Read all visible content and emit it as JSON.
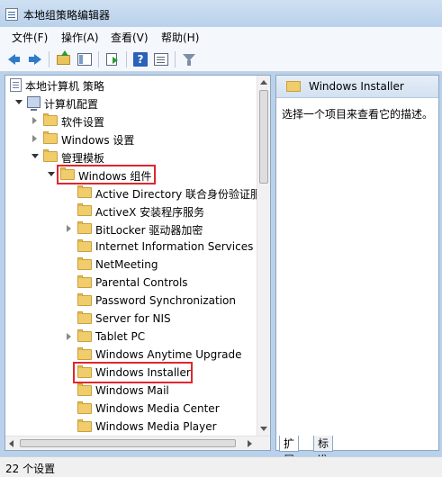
{
  "window": {
    "title": "本地组策略编辑器"
  },
  "menu": [
    "文件(F)",
    "操作(A)",
    "查看(V)",
    "帮助(H)"
  ],
  "toolbar": [
    "back-icon",
    "forward-icon",
    "folder-up-icon",
    "show-hide-tree-icon",
    "export-list-icon",
    "help-icon",
    "properties-icon",
    "filter-icon"
  ],
  "tree": [
    {
      "label": "本地计算机 策略",
      "icon": "policy-icon",
      "expand": "none"
    },
    {
      "label": "计算机配置",
      "icon": "computer-icon",
      "expand": "open"
    },
    {
      "label": "软件设置",
      "icon": "folder-icon",
      "expand": "closed"
    },
    {
      "label": "Windows 设置",
      "icon": "folder-icon",
      "expand": "closed"
    },
    {
      "label": "管理模板",
      "icon": "folder-icon",
      "expand": "open"
    },
    {
      "label": "Windows 组件",
      "icon": "folder-icon",
      "expand": "open",
      "highlighted": true
    },
    {
      "label": "Active Directory 联合身份验证服",
      "icon": "folder-icon",
      "expand": "none"
    },
    {
      "label": "ActiveX 安装程序服务",
      "icon": "folder-icon",
      "expand": "none"
    },
    {
      "label": "BitLocker 驱动器加密",
      "icon": "folder-icon",
      "expand": "closed"
    },
    {
      "label": "Internet Information Services",
      "icon": "folder-icon",
      "expand": "none"
    },
    {
      "label": "NetMeeting",
      "icon": "folder-icon",
      "expand": "none"
    },
    {
      "label": "Parental Controls",
      "icon": "folder-icon",
      "expand": "none"
    },
    {
      "label": "Password Synchronization",
      "icon": "folder-icon",
      "expand": "none"
    },
    {
      "label": "Server for NIS",
      "icon": "folder-icon",
      "expand": "none"
    },
    {
      "label": "Tablet PC",
      "icon": "folder-icon",
      "expand": "closed"
    },
    {
      "label": "Windows Anytime Upgrade",
      "icon": "folder-icon",
      "expand": "none"
    },
    {
      "label": "Windows Installer",
      "icon": "folder-icon",
      "expand": "none",
      "highlighted": true
    },
    {
      "label": "Windows Mail",
      "icon": "folder-icon",
      "expand": "none"
    },
    {
      "label": "Windows Media Center",
      "icon": "folder-icon",
      "expand": "none"
    },
    {
      "label": "Windows Media Player",
      "icon": "folder-icon",
      "expand": "none"
    }
  ],
  "details": {
    "title": "Windows Installer",
    "description": "选择一个项目来查看它的描述。"
  },
  "tabs": [
    "扩展",
    "标准"
  ],
  "status": "22 个设置",
  "colors": {
    "highlight_border": "#e0262e",
    "folder": "#f0cd6a"
  }
}
